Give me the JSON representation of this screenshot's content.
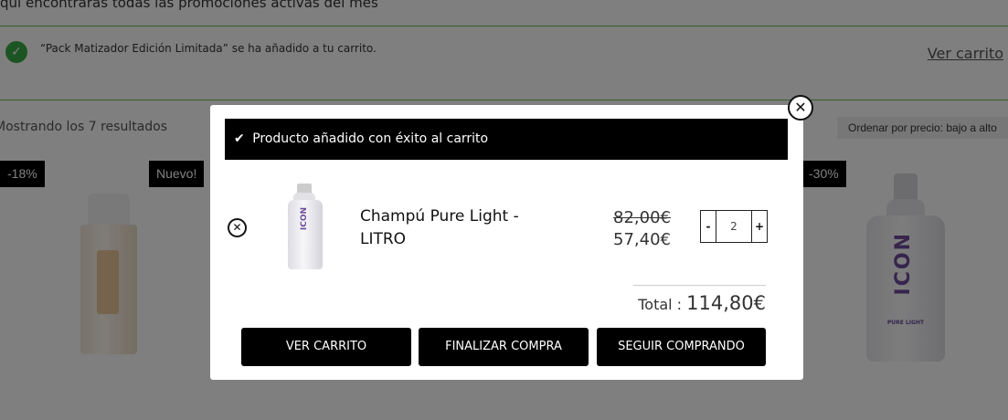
{
  "page": {
    "promo_text": "quí encontrarás todas las promociones activas del mes",
    "notice": {
      "message": "“Pack Matizador Edición Limitada” se ha añadido a tu carrito.",
      "link_label": "Ver carrito",
      "check_icon": "✓"
    },
    "results_text": "Mostrando los 7 resultados",
    "sort": {
      "selected": "Ordenar por precio: bajo a alto"
    },
    "badges": [
      "-18%",
      "Nuevo!",
      "-30%"
    ],
    "product_card": {
      "brand": "ICON",
      "line": "PURE LIGHT"
    }
  },
  "modal": {
    "close_icon": "✕",
    "success_message": "Producto añadido con éxito al carrito",
    "success_icon": "✔",
    "item": {
      "remove_icon": "✕",
      "thumb_brand": "ICON",
      "name": "Champú Pure Light - LITRO",
      "price_old": "82,00€",
      "price_new": "57,40€",
      "quantity": "2",
      "minus_label": "-",
      "plus_label": "+"
    },
    "total_label": "Total : ",
    "total_value": "114,80€",
    "buttons": {
      "view_cart": "VER CARRITO",
      "checkout": "FINALIZAR COMPRA",
      "continue": "SEGUIR COMPRANDO"
    }
  }
}
